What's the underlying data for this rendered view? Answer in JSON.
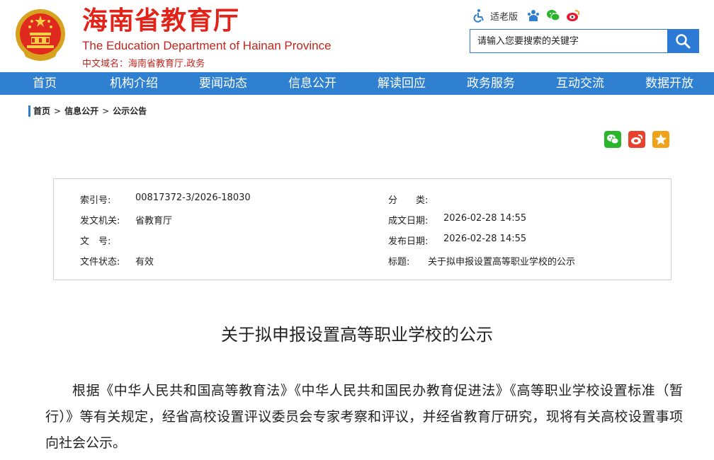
{
  "header": {
    "title_cn": "海南省教育厅",
    "title_en": "The Education Department of Hainan Province",
    "domain_label": "中文域名：",
    "domain_value": "海南省教育厅.政务",
    "brand_color": "#e2231a"
  },
  "tools": {
    "accessibility_icon": "wheelchair-icon",
    "elder_label": "适老版",
    "icons": [
      "people-icon",
      "wechat-icon",
      "weibo-icon"
    ]
  },
  "search": {
    "placeholder": "请输入您要搜索的关键字",
    "button_icon": "search-icon"
  },
  "nav": {
    "items": [
      {
        "label": "首页"
      },
      {
        "label": "机构介绍"
      },
      {
        "label": "要闻动态"
      },
      {
        "label": "信息公开"
      },
      {
        "label": "解读回应"
      },
      {
        "label": "政务服务"
      },
      {
        "label": "互动交流"
      },
      {
        "label": "数据开放"
      }
    ],
    "color": "#2f80d1"
  },
  "breadcrumb": {
    "items": [
      "首页",
      "信息公开",
      "公示公告"
    ],
    "separator": ">"
  },
  "share": {
    "icons": [
      "wechat-share-icon",
      "weibo-share-icon",
      "favorite-star-icon"
    ]
  },
  "meta": {
    "index_label": "索引号:",
    "index_value": "00817372-3/2026-18030",
    "category_label": "分　　类:",
    "category_value": "",
    "issuer_label": "发文机关:",
    "issuer_value": "省教育厅",
    "created_label": "成文日期:",
    "created_value": "2026-02-28 14:55",
    "docno_label": "文　号:",
    "docno_value": "",
    "published_label": "发布日期:",
    "published_value": "2026-02-28 14:55",
    "status_label": "文件状态:",
    "status_value": "有效",
    "subject_label": "标题:",
    "subject_value": "关于拟申报设置高等职业学校的公示"
  },
  "article": {
    "title": "关于拟申报设置高等职业学校的公示",
    "paragraph": "根据《中华人民共和国高等教育法》《中华人民共和国民办教育促进法》《高等职业学校设置标准（暂行）》等有关规定，经省高校设置评议委员会专家考察和评议，并经省教育厅研究，现将有关高校设置事项向社会公示。"
  }
}
